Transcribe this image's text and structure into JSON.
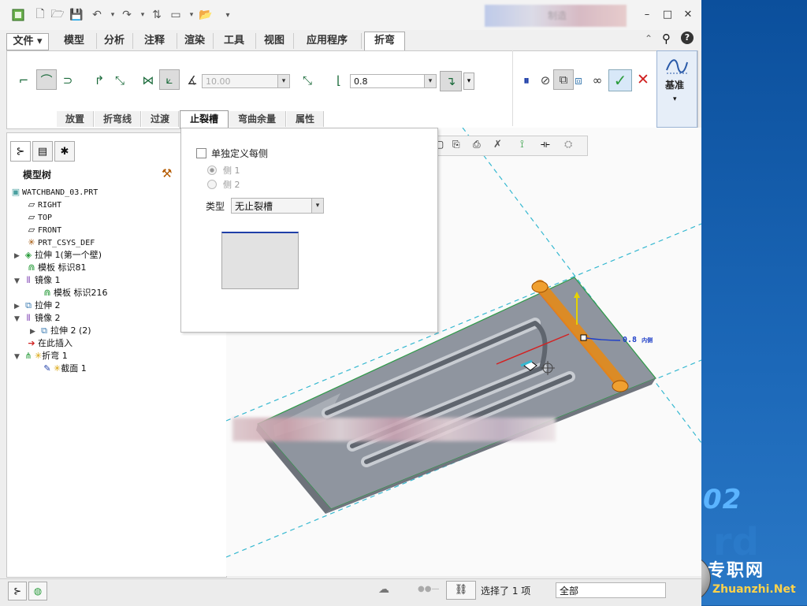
{
  "window": {
    "title": "制造"
  },
  "menu": [
    "文件",
    "模型",
    "分析",
    "注释",
    "渲染",
    "工具",
    "视图",
    "应用程序",
    "折弯"
  ],
  "ribbon": {
    "angle_value": "10.00",
    "radius_value": "0.8",
    "subtabs": [
      "放置",
      "折弯线",
      "过渡",
      "止裂槽",
      "弯曲余量",
      "属性"
    ],
    "active_subtab": "止裂槽",
    "datum_label": "基准"
  },
  "relief_panel": {
    "checkbox_label": "单独定义每侧",
    "radio_side1": "侧 1",
    "radio_side2": "侧 2",
    "type_label": "类型",
    "type_value": "无止裂槽"
  },
  "tree": {
    "title": "模型树",
    "items": [
      {
        "label": "WATCHBAND_03.PRT",
        "mono": true
      },
      {
        "label": "RIGHT",
        "mono": true
      },
      {
        "label": "TOP",
        "mono": true
      },
      {
        "label": "FRONT",
        "mono": true
      },
      {
        "label": "PRT_CSYS_DEF",
        "mono": true
      },
      {
        "label": "拉伸 1(第一个壁)"
      },
      {
        "label": "模板 标识81"
      },
      {
        "label": "镜像 1"
      },
      {
        "label": "模板 标识216"
      },
      {
        "label": "拉伸 2"
      },
      {
        "label": "镜像 2"
      },
      {
        "label": "拉伸 2 (2)"
      },
      {
        "label": "在此插入"
      },
      {
        "label": "折弯 1"
      },
      {
        "label": "截面 1"
      }
    ]
  },
  "viewport": {
    "dimension_label": "0.8",
    "dimension_suffix": "内侧"
  },
  "status": {
    "selection_text": "选择了 1 项",
    "filter_value": "全部"
  },
  "background": {
    "version_text": "02",
    "faded_text": "rd"
  },
  "watermark": {
    "cn": "专职网",
    "en": "Zhuanzhi.Net"
  },
  "colors": {
    "accent_green": "#2a9c3c",
    "bend_orange": "#e48a1a",
    "dim_blue": "#1f3fc8"
  }
}
